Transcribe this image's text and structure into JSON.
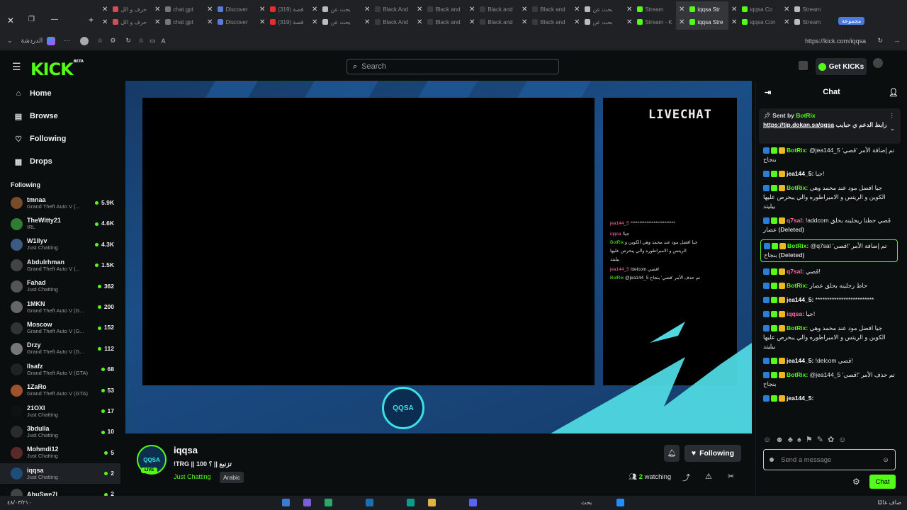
{
  "browser": {
    "tabs_row1": [
      "حرف و الل",
      "chat gpt",
      "Discover",
      "(319) قصة",
      "بحث عن",
      "Black And",
      "Black and",
      "Black and",
      "Black and",
      "بحث عن",
      "Stream",
      "iqqsa Str",
      "iqqsa Co",
      "Stream"
    ],
    "tabs_row2": [
      "حرف و الل",
      "chat gpt",
      "Discover",
      "(319) قصة",
      "بحث عن",
      "Black And",
      "Black and",
      "Black and",
      "Black and",
      "بحث عن",
      "Stream - K",
      "iqqsa Stre",
      "iqqsa Con",
      "Stream"
    ],
    "group_label": "مجموعة",
    "profile_label": "الدردشة",
    "url": "https://kick.com/iqqsa"
  },
  "header": {
    "logo": "KICK",
    "logo_sup": "BETA",
    "search_placeholder": "Search",
    "get_kicks": "Get KICKs"
  },
  "sidebar": {
    "nav": [
      {
        "label": "Home",
        "icon": "home-icon"
      },
      {
        "label": "Browse",
        "icon": "browse-icon"
      },
      {
        "label": "Following",
        "icon": "heart-icon"
      },
      {
        "label": "Drops",
        "icon": "drops-icon"
      }
    ],
    "following_title": "Following",
    "channels": [
      {
        "name": "tmnaa",
        "category": "Grand Theft Auto V (...",
        "viewers": "5.9K",
        "color": "#7a4b2a"
      },
      {
        "name": "TheWitty21",
        "category": "IRL",
        "viewers": "4.6K",
        "color": "#2e7d32"
      },
      {
        "name": "W1llyv",
        "category": "Just Chatting",
        "viewers": "4.3K",
        "color": "#3d5a80"
      },
      {
        "name": "Abdulrhman",
        "category": "Grand Theft Auto V (...",
        "viewers": "1.5K",
        "color": "#444"
      },
      {
        "name": "Fahad",
        "category": "Just Chatting",
        "viewers": "362",
        "color": "#555"
      },
      {
        "name": "1MKN",
        "category": "Grand Theft Auto V (G...",
        "viewers": "200",
        "color": "#666"
      },
      {
        "name": "Moscow",
        "category": "Grand Theft Auto V (G...",
        "viewers": "152",
        "color": "#333"
      },
      {
        "name": "Drzy",
        "category": "Grand Theft Auto V (G...",
        "viewers": "112",
        "color": "#777"
      },
      {
        "name": "Ilsafz",
        "category": "Grand Theft Auto V (GTA)",
        "viewers": "68",
        "color": "#222"
      },
      {
        "name": "1ZaRo",
        "category": "Grand Theft Auto V (GTA)",
        "viewers": "53",
        "color": "#a0522d"
      },
      {
        "name": "21OXI",
        "category": "Just Chatting",
        "viewers": "17",
        "color": "#111"
      },
      {
        "name": "3bdulla",
        "category": "Just Chatting",
        "viewers": "10",
        "color": "#2b2b2b"
      },
      {
        "name": "Mohmdi12",
        "category": "Just Chatting",
        "viewers": "5",
        "color": "#5a2a2a"
      },
      {
        "name": "iqqsa",
        "category": "Just Chatting",
        "viewers": "2",
        "color": "#1e4d7a"
      },
      {
        "name": "AbuSwe7l",
        "category": "",
        "viewers": "2",
        "color": "#444"
      }
    ]
  },
  "player": {
    "livechat_label": "LIVECHAT",
    "overlay_lines": [
      {
        "user": "jea144_5",
        "text": "*************************",
        "cls": "pk"
      },
      {
        "user": "iqqsa",
        "text": "!جيا",
        "cls": "pk"
      },
      {
        "user": "BotRix",
        "text": "جيا افضل مود عند محمد وهي الكوين و",
        "cls": "gr"
      },
      {
        "user": "",
        "text": "الريتس و الامبراطوره والي يبحرص عليها",
        "cls": ""
      },
      {
        "user": "",
        "text": "بيليتد",
        "cls": ""
      },
      {
        "user": "jea144_5",
        "text": "!delcom قصي!",
        "cls": "pk"
      },
      {
        "user": "BotRix",
        "text": "@jea144_5 تم حذف الأمر 'قصي' بنجاح",
        "cls": "gr"
      }
    ],
    "emblem": "QQSA"
  },
  "channel": {
    "avatar": "QQSA",
    "live_badge": "LIVE",
    "name": "iqqsa",
    "title": "!TRG || 100 تزنيع || ؟",
    "category": "Just Chatting",
    "language": "Arabic",
    "following_label": "Following",
    "watching_count": "2",
    "watching_label": "watching"
  },
  "chat": {
    "title": "Chat",
    "pinned_sent_by": "Sent by",
    "pinned_user": "BotRix",
    "pinned_link": "https://tip.dokan.sa/qqsa",
    "pinned_text": "رابط الدعم ي حبايب",
    "messages": [
      {
        "user": "BotRix",
        "color": "#53fc18",
        "text": ": @jea144_5 تم إضافة الأمر 'قصي' بنجاح",
        "hl": false,
        "deleted": false
      },
      {
        "user": "jea144_5:",
        "color": "#ffffff",
        "text": " جيا!",
        "hl": false,
        "deleted": false
      },
      {
        "user": "BotRix:",
        "color": "#53fc18",
        "text": " جيا افضل مود عند محمد وهي الكوين و الريتس و الامبراطوره والي يبحرص عليها بيليتد",
        "hl": false,
        "deleted": false
      },
      {
        "user": "q7sal:",
        "color": "#ff6ba9",
        "text": " !addcom قصي حطنا ريجلينه بحلق عصار",
        "hl": false,
        "deleted": true
      },
      {
        "user": "BotRix:",
        "color": "#53fc18",
        "text": " @q7sal تم إضافة الأمر '!قصي' بنجاح",
        "hl": true,
        "deleted": true
      },
      {
        "user": "q7sal:",
        "color": "#ff6ba9",
        "text": " قصي!",
        "hl": false,
        "deleted": false
      },
      {
        "user": "BotRix:",
        "color": "#53fc18",
        "text": " حاط رجلينه بحلق عصار",
        "hl": false,
        "deleted": false
      },
      {
        "user": "jea144_5:",
        "color": "#ffffff",
        "text": " *************************",
        "hl": false,
        "deleted": false
      },
      {
        "user": "iqqsa:",
        "color": "#ff6ba9",
        "text": " جيا!",
        "hl": false,
        "deleted": false
      },
      {
        "user": "BotRix:",
        "color": "#53fc18",
        "text": " جيا افضل مود عند محمد وهي الكوين و الريتس و الامبراطوره والي يبحرص عليها بيليتد",
        "hl": false,
        "deleted": false
      },
      {
        "user": "jea144_5:",
        "color": "#ffffff",
        "text": " !delcom قصي!",
        "hl": false,
        "deleted": false
      },
      {
        "user": "BotRix:",
        "color": "#53fc18",
        "text": " @jea144_5 تم حذف الأمر '!قصي' بنجاح",
        "hl": false,
        "deleted": false
      },
      {
        "user": "jea144_5:",
        "color": "#ffffff",
        "text": "",
        "hl": false,
        "deleted": false
      }
    ],
    "deleted_label": "(Deleted)",
    "input_placeholder": "Send a message",
    "send_label": "Chat"
  },
  "taskbar": {
    "search_label": "بحث",
    "time": "٤٨/٠٣/٢١٠",
    "weather": "صاف غالبًا"
  }
}
